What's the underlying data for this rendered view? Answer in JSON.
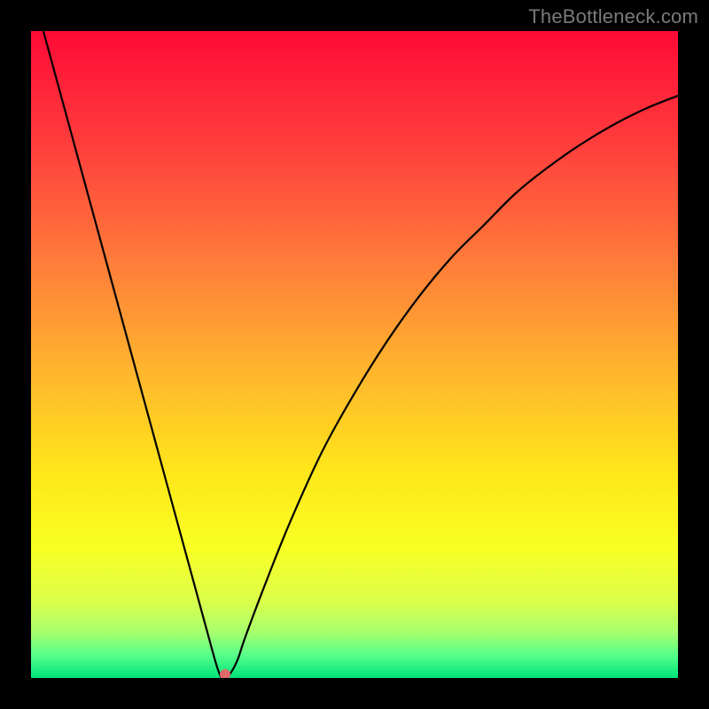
{
  "attribution": "TheBottleneck.com",
  "chart_data": {
    "type": "line",
    "title": "",
    "xlabel": "",
    "ylabel": "",
    "xlim": [
      0,
      100
    ],
    "ylim": [
      0,
      100
    ],
    "x": [
      0,
      3,
      6,
      9,
      12,
      15,
      18,
      21,
      24,
      27,
      29,
      30,
      31,
      32,
      33,
      36,
      40,
      45,
      50,
      55,
      60,
      65,
      70,
      75,
      80,
      85,
      90,
      95,
      100
    ],
    "values": [
      107,
      96,
      85,
      74,
      63,
      52,
      41,
      30,
      19,
      8,
      1,
      0,
      1,
      3,
      6,
      14,
      24,
      35,
      44,
      52,
      59,
      65,
      70,
      75,
      79,
      82.5,
      85.5,
      88,
      90
    ],
    "marker": {
      "x": 30,
      "y": 0
    },
    "gradient_stops": [
      {
        "offset": 0.0,
        "color": "#ff0a36"
      },
      {
        "offset": 0.18,
        "color": "#ff3f3c"
      },
      {
        "offset": 0.35,
        "color": "#ff7a3a"
      },
      {
        "offset": 0.52,
        "color": "#ffb32e"
      },
      {
        "offset": 0.68,
        "color": "#ffe61a"
      },
      {
        "offset": 0.8,
        "color": "#f8ff23"
      },
      {
        "offset": 0.88,
        "color": "#dcff4a"
      },
      {
        "offset": 0.93,
        "color": "#a7ff6e"
      },
      {
        "offset": 0.965,
        "color": "#55ff8a"
      },
      {
        "offset": 1.0,
        "color": "#00e47a"
      }
    ]
  }
}
